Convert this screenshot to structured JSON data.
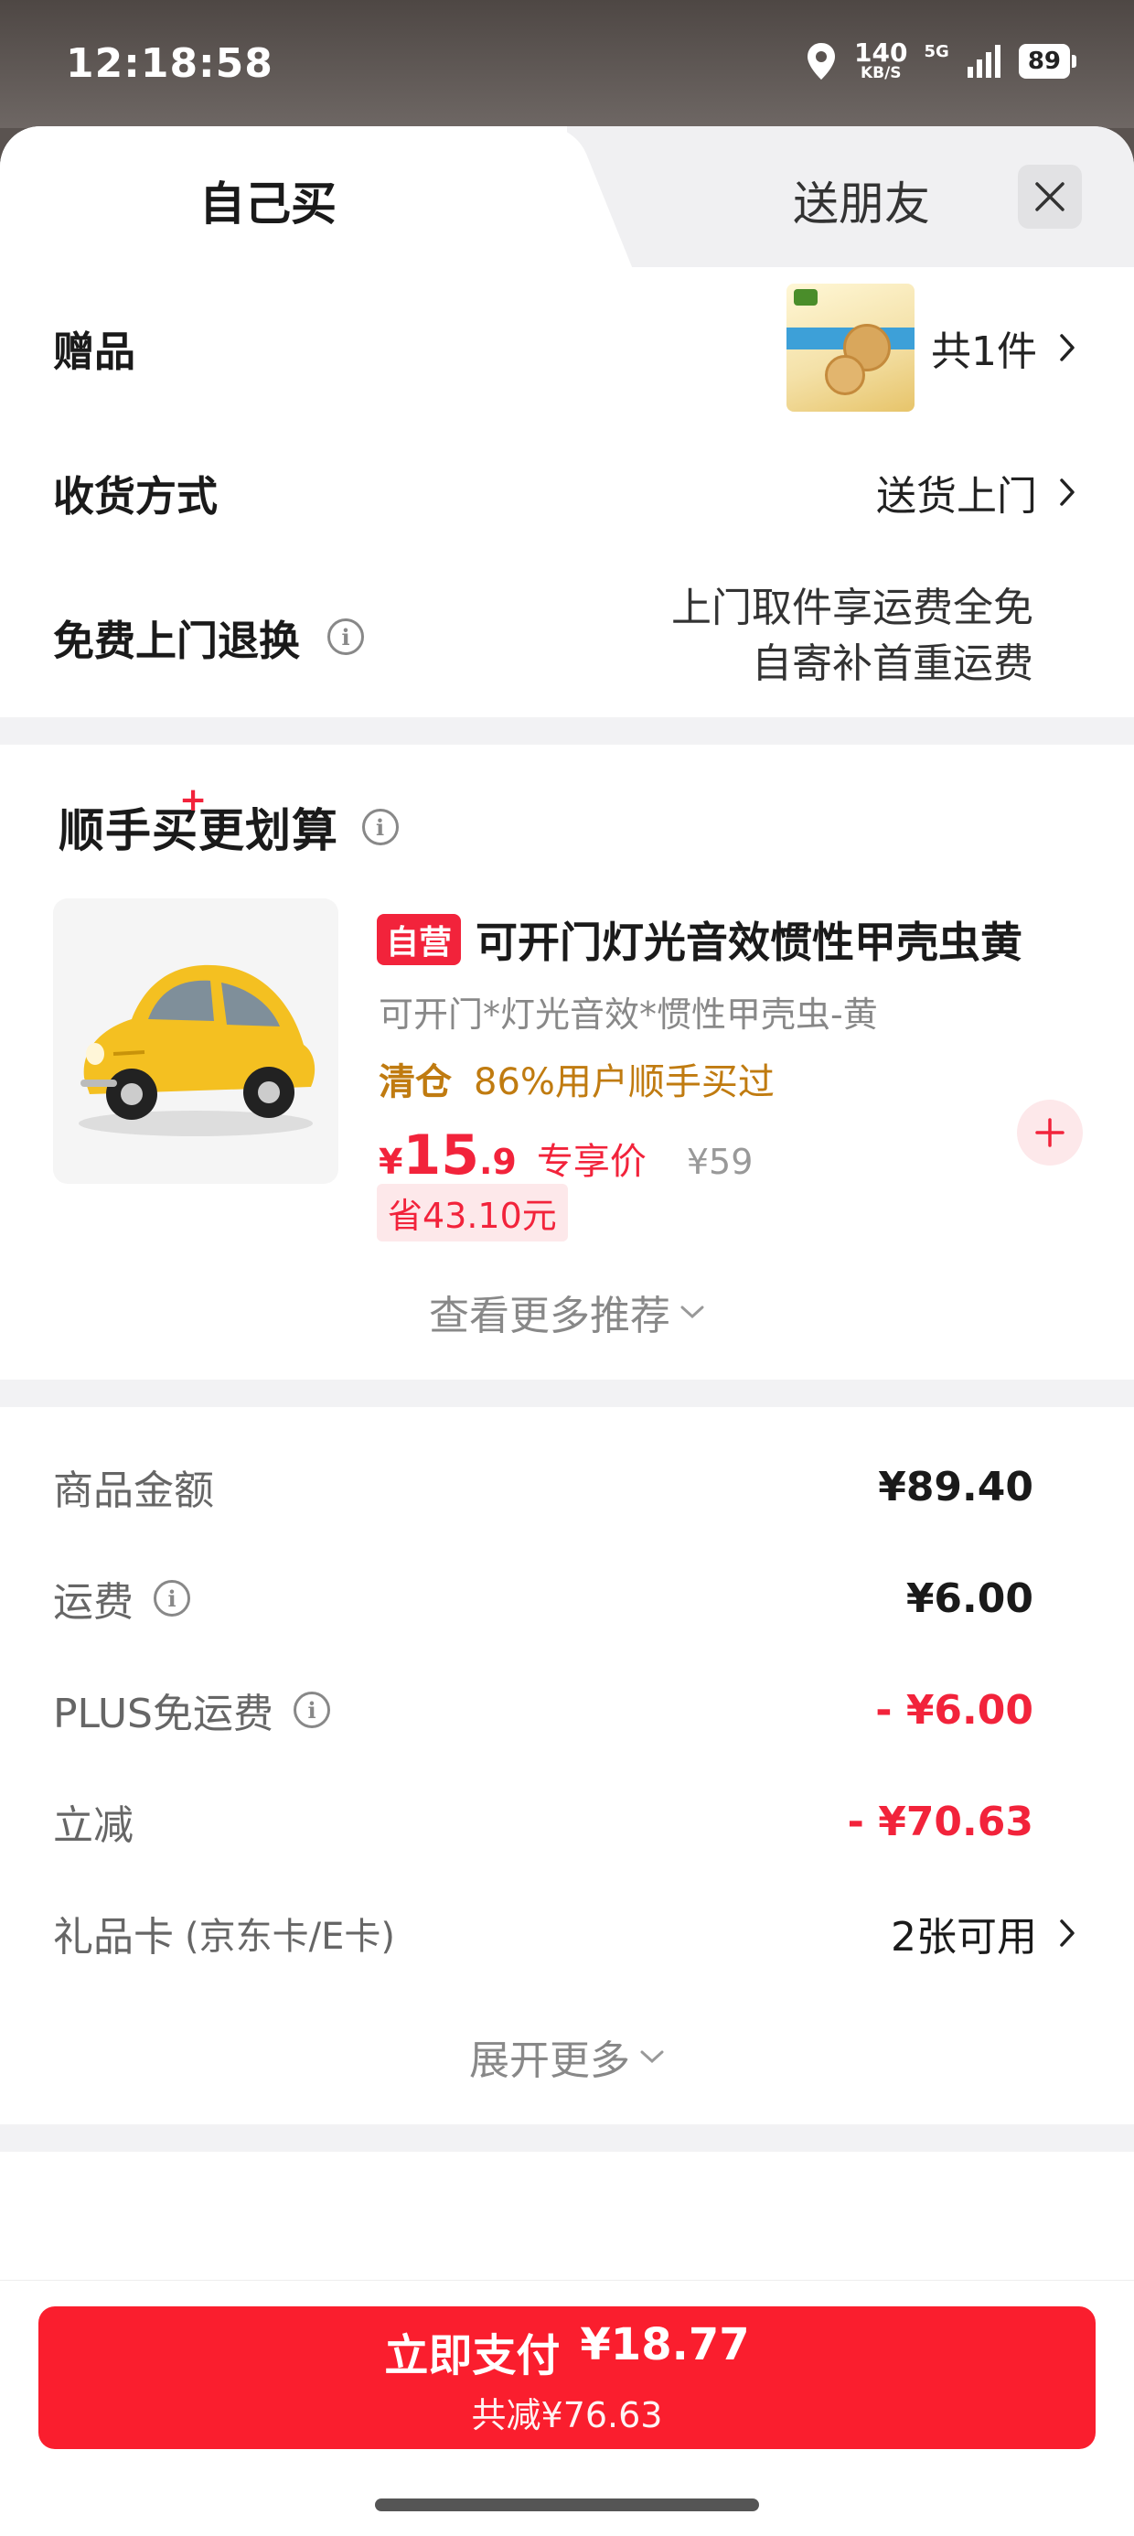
{
  "status_bar": {
    "time": "12:18:58",
    "net_speed_value": "140",
    "net_speed_unit": "KB/S",
    "network": "5G",
    "battery": "89"
  },
  "tabs": {
    "buy_self": "自己买",
    "send_friend": "送朋友"
  },
  "gift": {
    "label": "赠品",
    "count": "共1件"
  },
  "delivery": {
    "label": "收货方式",
    "value": "送货上门"
  },
  "returns": {
    "label": "免费上门退换",
    "line1": "上门取件享运费全免",
    "line2": "自寄补首重运费"
  },
  "addon": {
    "title_part1": "顺手买",
    "title_part2": "更划算",
    "plus": "+",
    "product": {
      "badge": "自营",
      "name": "可开门灯光音效惯性甲壳虫黄",
      "spec": "可开门*灯光音效*惯性甲壳虫-黄",
      "tag": "清仓",
      "tag_text": "86%用户顺手买过",
      "currency": "¥",
      "price_int": "15",
      "price_dec": ".9",
      "price_tag": "专享价",
      "original_price": "¥59",
      "save": "省43.10元"
    },
    "more": "查看更多推荐"
  },
  "fees": {
    "goods_label": "商品金额",
    "goods_value": "¥89.40",
    "shipping_label": "运费",
    "shipping_value": "¥6.00",
    "plus_label": "PLUS免运费",
    "plus_value": "- ¥6.00",
    "discount_label": "立减",
    "discount_value": "- ¥70.63",
    "giftcard_label": "礼品卡",
    "giftcard_sub": "(京东卡/E卡)",
    "giftcard_value": "2张可用",
    "expand": "展开更多"
  },
  "pay": {
    "label": "立即支付",
    "amount": "¥18.77",
    "saved": "共减¥76.63"
  },
  "colors": {
    "accent": "#f2233b",
    "pay_button": "#fa1e2e",
    "tag_gold": "#c07b10"
  }
}
